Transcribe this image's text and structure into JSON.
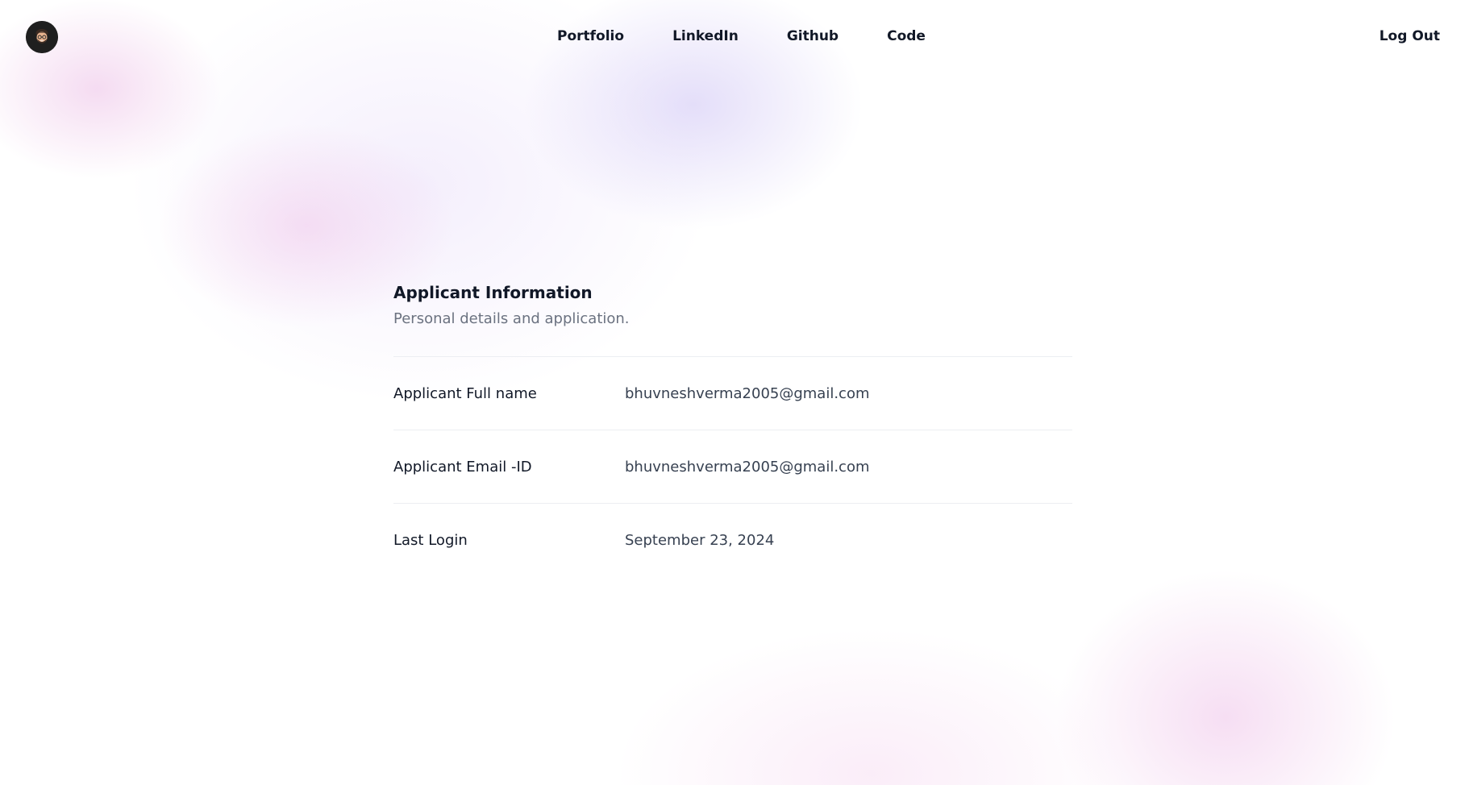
{
  "header": {
    "avatar_alt": "user avatar",
    "nav": [
      {
        "label": "Portfolio"
      },
      {
        "label": "LinkedIn"
      },
      {
        "label": "Github"
      },
      {
        "label": "Code"
      }
    ],
    "logout_label": "Log Out"
  },
  "section": {
    "title": "Applicant Information",
    "subtitle": "Personal details and application.",
    "rows": [
      {
        "label": "Applicant Full name",
        "value": "bhuvneshverma2005@gmail.com"
      },
      {
        "label": "Applicant Email -ID",
        "value": "bhuvneshverma2005@gmail.com"
      },
      {
        "label": "Last Login",
        "value": "September 23, 2024"
      }
    ]
  },
  "colors": {
    "text_primary": "#111827",
    "text_secondary": "#6b7280",
    "divider": "#eceef2",
    "avatar_bg": "#1f1f1f"
  },
  "icons": {
    "avatar": "memoji-avatar-icon"
  }
}
